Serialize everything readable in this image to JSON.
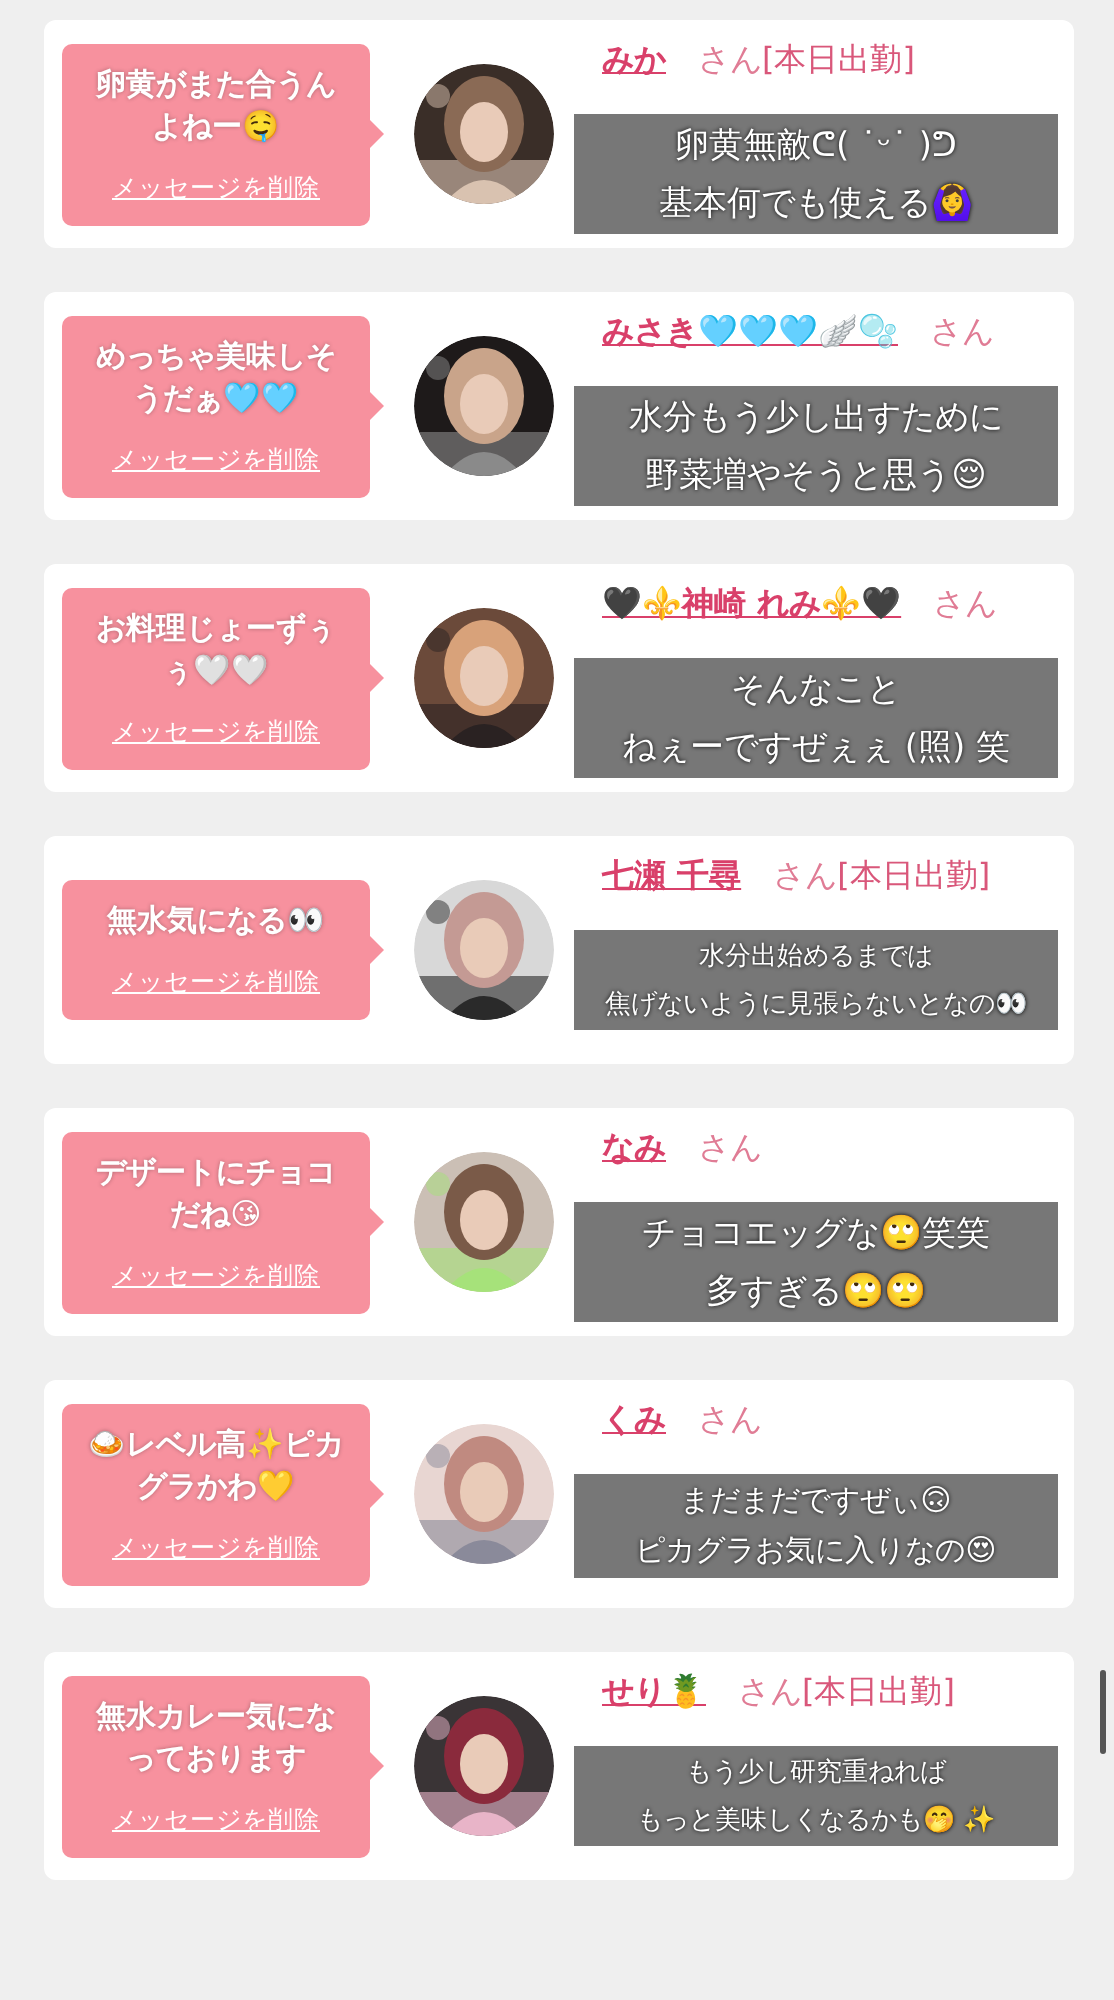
{
  "messages": [
    {
      "message": "卵黄がまた合うんよねー🤤",
      "delete_link": "メッセージを削除",
      "cast": {
        "name": "みか",
        "honorific": "さん",
        "status": "[本日出勤]"
      },
      "reply": {
        "kind": "large",
        "lines": [
          "卵黄無敵ᕦ( ˙ᵕ˙ )ᕤ",
          "基本何でも使える🙆‍♀️"
        ]
      }
    },
    {
      "message": "めっちゃ美味しそうだぁ🩵🩵",
      "delete_link": "メッセージを削除",
      "cast": {
        "name": "みさき🩵🩵🩵🪽🫧",
        "honorific": "さん"
      },
      "reply": {
        "kind": "large",
        "lines": [
          "水分もう少し出すために",
          "野菜増やそうと思う😌"
        ]
      }
    },
    {
      "message": "お料理じょーずぅぅ🤍🤍",
      "delete_link": "メッセージを削除",
      "cast": {
        "name": "🖤⚜️神崎 れみ⚜️🖤",
        "honorific": "さん"
      },
      "reply": {
        "kind": "large",
        "lines": [
          "そんなこと",
          "ねぇーですぜぇぇ (照) 笑"
        ]
      }
    },
    {
      "message": "無水気になる👀",
      "delete_link": "メッセージを削除",
      "cast": {
        "name": "七瀬 千尋",
        "honorific": "さん",
        "status": "[本日出勤]"
      },
      "reply": {
        "kind": "small",
        "lines": [
          "水分出始めるまでは",
          "焦げないように見張らないとなの👀"
        ]
      }
    },
    {
      "message": "デザートにチョコだね😘",
      "delete_link": "メッセージを削除",
      "cast": {
        "name": "なみ",
        "honorific": "さん"
      },
      "reply": {
        "kind": "large",
        "lines": [
          "チョコエッグな🙄笑笑",
          "多すぎる🙄🙄"
        ]
      }
    },
    {
      "message": "🍛レベル高✨ピカグラかわ💛",
      "delete_link": "メッセージを削除",
      "cast": {
        "name": "くみ",
        "honorific": "さん"
      },
      "reply": {
        "kind": "medium",
        "lines": [
          "まだまだですぜぃ🙃",
          "ピカグラお気に入りなの😍"
        ]
      }
    },
    {
      "message": "無水カレー気になっております",
      "delete_link": "メッセージを削除",
      "cast": {
        "name": "せり🍍",
        "honorific": "さん",
        "status": "[本日出勤]"
      },
      "reply": {
        "kind": "small",
        "lines": [
          "もう少し研究重ねれば",
          "もっと美味しくなるかも🤭 ✨"
        ]
      }
    }
  ]
}
